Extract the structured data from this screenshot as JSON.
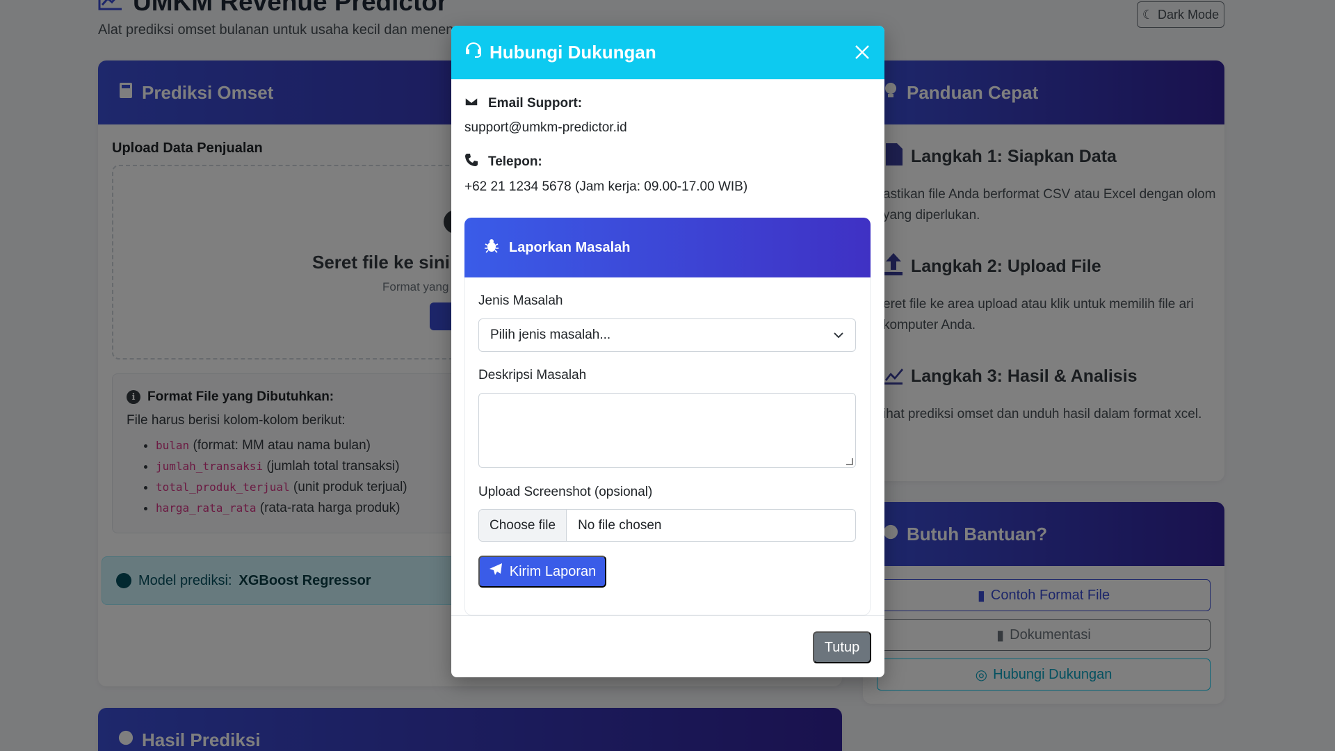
{
  "app": {
    "title": "UMKM Revenue Predictor",
    "subtitle": "Alat prediksi omset bulanan untuk usaha kecil dan menen",
    "dark_mode_label": "Dark Mode"
  },
  "predict_card": {
    "title": "Prediksi Omset",
    "upload_label": "Upload Data Penjualan",
    "dropzone_title": "Seret file ke sini a",
    "dropzone_format": "Format yang",
    "format_box": {
      "title": "Format File yang Dibutuhkan:",
      "desc": "File harus berisi kolom-kolom berikut:",
      "columns": [
        {
          "code": "bulan",
          "desc": " (format: MM atau nama bulan)"
        },
        {
          "code": "jumlah_transaksi",
          "desc": " (jumlah total transaksi)"
        },
        {
          "code": "total_produk_terjual",
          "desc": " (unit produk terjual)"
        },
        {
          "code": "harga_rata_rata",
          "desc": " (rata-rata harga produk)"
        }
      ]
    },
    "model_prefix": "Model prediksi:",
    "model_name": "XGBoost Regressor"
  },
  "result_card": {
    "title": "Hasil Prediksi"
  },
  "guide_card": {
    "title": "Panduan Cepat",
    "steps": [
      {
        "title": "Langkah 1: Siapkan Data",
        "text": "astikan file Anda berformat CSV atau Excel dengan olom yang diperlukan."
      },
      {
        "title": "Langkah 2: Upload File",
        "text": "eret file ke area upload atau klik untuk memilih file ari komputer Anda."
      },
      {
        "title": "Langkah 3: Hasil & Analisis",
        "text": "ihat prediksi omset dan unduh hasil dalam format xcel."
      }
    ]
  },
  "help_card": {
    "title": "Butuh Bantuan?",
    "buttons": [
      "Contoh Format File",
      "Dokumentasi",
      "Hubungi Dukungan"
    ]
  },
  "modal": {
    "title": "Hubungi Dukungan",
    "email_label": "Email Support:",
    "email_value": "support@umkm-predictor.id",
    "phone_label": "Telepon:",
    "phone_value": "+62 21 1234 5678 (Jam kerja: 09.00-17.00 WIB)",
    "report": {
      "title": "Laporkan Masalah",
      "issue_type_label": "Jenis Masalah",
      "issue_type_value": "Pilih jenis masalah...",
      "description_label": "Deskripsi Masalah",
      "description_value": "",
      "screenshot_label": "Upload Screenshot (opsional)",
      "choose_file": "Choose file",
      "no_file": "No file chosen",
      "submit": "Kirim Laporan"
    },
    "close_label": "Tutup"
  },
  "colors": {
    "accent": "#3a5ce8",
    "header_gradient_start": "#3c50d8",
    "header_gradient_end": "#33249c",
    "modal_header": "#0dcaf0"
  }
}
